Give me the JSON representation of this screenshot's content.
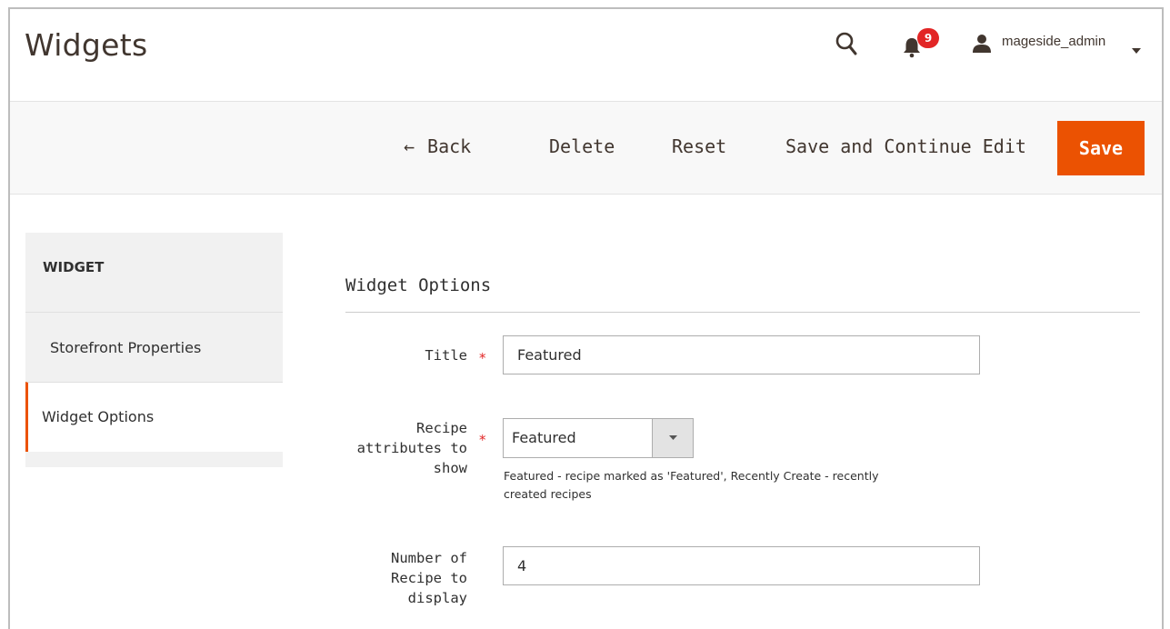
{
  "header": {
    "title": "Widgets",
    "notifications_count": "9",
    "username": "mageside_admin"
  },
  "actions": {
    "back": "Back",
    "delete": "Delete",
    "reset": "Reset",
    "save_continue": "Save and Continue Edit",
    "save": "Save"
  },
  "sidebar": {
    "heading": "WIDGET",
    "items": [
      {
        "label": "Storefront Properties",
        "active": false
      },
      {
        "label": "Widget Options",
        "active": true
      }
    ]
  },
  "main": {
    "section_title": "Widget Options",
    "fields": {
      "title": {
        "label": "Title",
        "value": "Featured",
        "required": true
      },
      "recipe_attributes": {
        "label_lines": [
          "Recipe",
          "attributes to",
          "show"
        ],
        "selected": "Featured",
        "required": true,
        "note_lines": [
          "Featured - recipe marked as 'Featured', Recently Create - recently",
          "created recipes"
        ]
      },
      "number_of_recipe": {
        "label_lines": [
          "Number of",
          "Recipe to",
          "display"
        ],
        "value": "4"
      }
    }
  },
  "colors": {
    "accent": "#eb5202",
    "badge": "#e22626",
    "required": "#e22626",
    "action_bar_bg": "#f8f8f8",
    "sidebar_bg": "#f1f1f1"
  }
}
